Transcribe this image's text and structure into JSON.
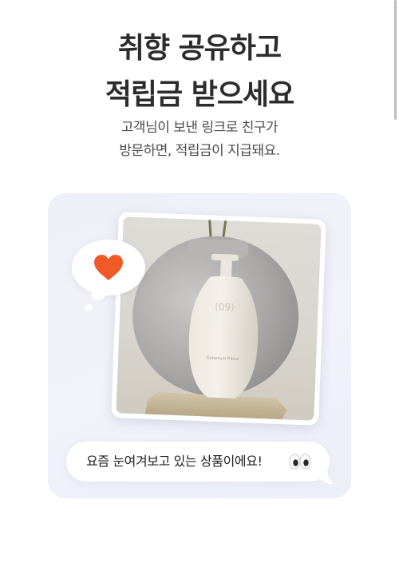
{
  "headline": {
    "line1": "취향 공유하고",
    "line2": "적립금 받으세요"
  },
  "subtext": {
    "line1": "고객님이 보낸 링크로 친구가",
    "line2": "방문하면, 적립금이 지급돼요."
  },
  "card": {
    "chat_message": "요즘 눈여겨보고 있는 상품이에요!",
    "chat_icon": "eyes-emoji",
    "reaction_icon": "heart-icon",
    "heart_color": "#F05A28",
    "product_label": "Geranium Ritual",
    "product_brand": "(09)"
  }
}
